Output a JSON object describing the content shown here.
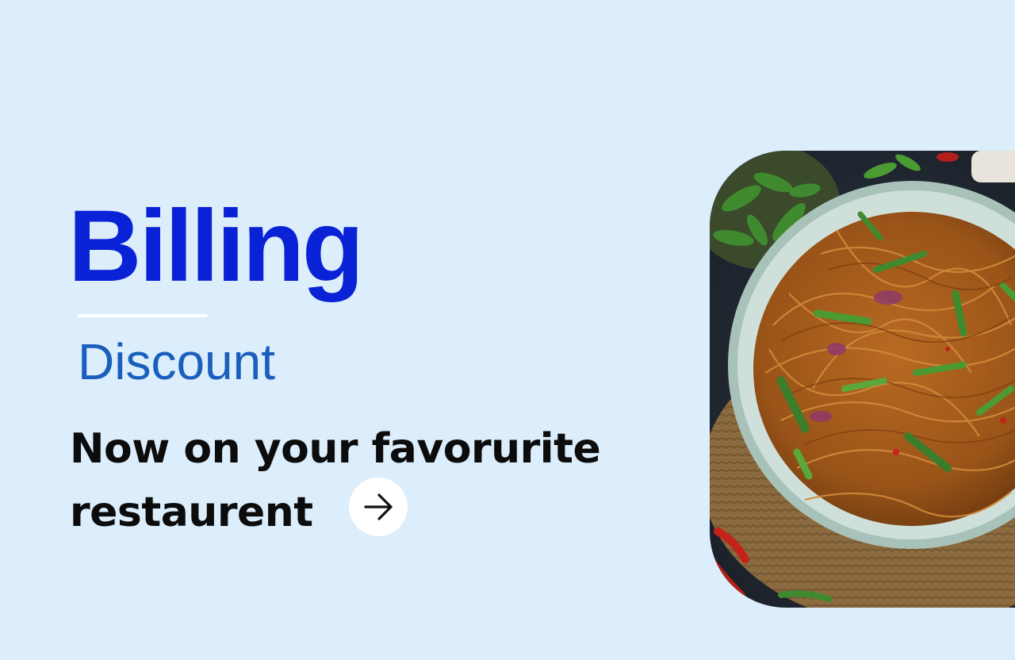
{
  "hero": {
    "title": "Billing",
    "subtitle": "Discount",
    "tagline": "Now on your favorurite restaurent"
  },
  "next_button": {
    "icon": "arrow-right-icon"
  },
  "image": {
    "subject": "food-photo-noodles-bowl"
  },
  "colors": {
    "background": "#dcedfb",
    "title": "#0a22d6",
    "subtitle": "#1a5fbd",
    "tagline": "#0c0c0c",
    "button": "#ffffff"
  }
}
